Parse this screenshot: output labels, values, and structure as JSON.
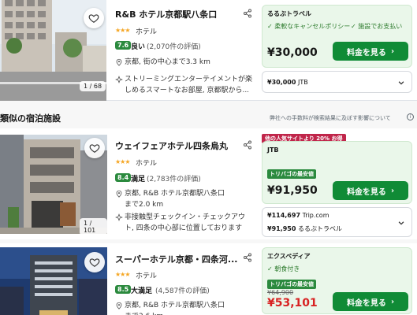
{
  "hotels": [
    {
      "name": "R&B ホテル京都駅八条口",
      "stars": "★★★",
      "type": "ホテル",
      "score": "7.6",
      "score_word": "良い",
      "review_count": "(2,070件の評価)",
      "location": "京都, 街の中心まで3.3 km",
      "amenity": "ストリーミングエンターテイメントが楽しめるスマートなお部屋, 京都駅から...",
      "photo_counter": "1 / 68",
      "offer": {
        "site": "るるぶトラベル",
        "feature_1": "柔軟なキャンセルポリシー",
        "feature_2": "施設でお支払い",
        "price": "¥30,000",
        "button": "料金を見る"
      },
      "alt_offer": {
        "price": "¥30,000",
        "site": "JTB"
      }
    },
    {
      "name": "ウェイフェアホテル四条烏丸",
      "stars": "★★★",
      "type": "ホテル",
      "score": "8.4",
      "score_word": "満足",
      "review_count": "(2,783件の評価)",
      "location": "京都, R&B ホテル京都駅八条口まで2.0 km",
      "amenity": "非接触型チェックイン・チェックアウト, 四条の中心部に位置しております",
      "photo_counter": "1 / 101",
      "offer": {
        "promo": "他の人気サイトより 20% お得",
        "site": "JTB",
        "best_tag": "トリバゴの最安値",
        "price": "¥91,950",
        "button": "料金を見る"
      },
      "alt_offers": [
        {
          "price": "¥114,697",
          "site": "Trip.com"
        },
        {
          "price": "¥91,950",
          "site": "るるぶトラベル"
        }
      ]
    },
    {
      "name": "スーパーホテル京都・四条河...",
      "stars": "★★★",
      "type": "ホテル",
      "score": "8.5",
      "score_word": "大満足",
      "review_count": "(4,587件の評価)",
      "location": "京都, R&B ホテル京都駅八条口まで2.6 km",
      "offer": {
        "site": "エクスペディア",
        "feature_1": "朝食付き",
        "best_tag": "トリバゴの最安値",
        "old_price": "¥64,900",
        "price": "¥53,101",
        "button": "料金を見る"
      }
    }
  ],
  "section": {
    "title": "類似の宿泊施設",
    "notice": "弊社への手数料が検索結果に及ぼす影響について",
    "info_icon": "i"
  },
  "icons": {
    "heart": "heart-icon",
    "share": "share-icon",
    "pin": "pin-icon",
    "amenity": "amenity-icon",
    "arrow": "arrow-right-icon",
    "chevron": "chevron-down-icon",
    "info": "info-icon"
  },
  "colors": {
    "green_badge": "#2b8a3e",
    "button_green": "#108b36",
    "offer_bg": "#eaf7ea",
    "promo_pink": "#c0254a",
    "price_red": "#d82222"
  }
}
